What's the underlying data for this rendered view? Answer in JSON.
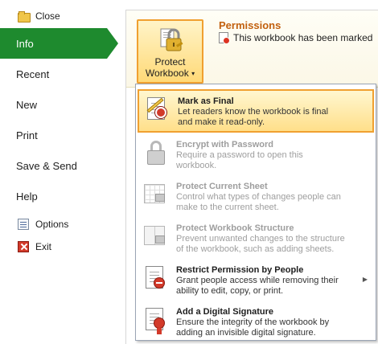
{
  "nav": {
    "close": "Close",
    "info": "Info",
    "recent": "Recent",
    "new": "New",
    "print": "Print",
    "save_send": "Save & Send",
    "help": "Help",
    "options": "Options",
    "exit": "Exit"
  },
  "accent_color": "#1e8a2e",
  "permissions": {
    "button_line1": "Protect",
    "button_line2": "Workbook",
    "title": "Permissions",
    "description": "This workbook has been marked"
  },
  "menu": {
    "items": [
      {
        "title": "Mark as Final",
        "desc1": "Let readers know the workbook is final",
        "desc2": "and make it read-only.",
        "icon": "mark-final-icon",
        "disabled": false,
        "highlighted": true
      },
      {
        "title": "Encrypt with Password",
        "desc1": "Require a password to open this",
        "desc2": "workbook.",
        "icon": "lock-icon",
        "disabled": true
      },
      {
        "title": "Protect Current Sheet",
        "desc1": "Control what types of changes people can",
        "desc2": "make to the current sheet.",
        "icon": "sheet-lock-icon",
        "disabled": true
      },
      {
        "title": "Protect Workbook Structure",
        "desc1": "Prevent unwanted changes to the structure",
        "desc2": "of the workbook, such as adding sheets.",
        "icon": "workbook-structure-icon",
        "disabled": true
      },
      {
        "title": "Restrict Permission by People",
        "desc1": "Grant people access while removing their",
        "desc2": "ability to edit, copy, or print.",
        "icon": "restrict-permission-icon",
        "disabled": false
      },
      {
        "title": "Add a Digital Signature",
        "desc1": "Ensure the integrity of the workbook by",
        "desc2": "adding an invisible digital signature.",
        "icon": "digital-signature-icon",
        "disabled": false
      }
    ]
  }
}
